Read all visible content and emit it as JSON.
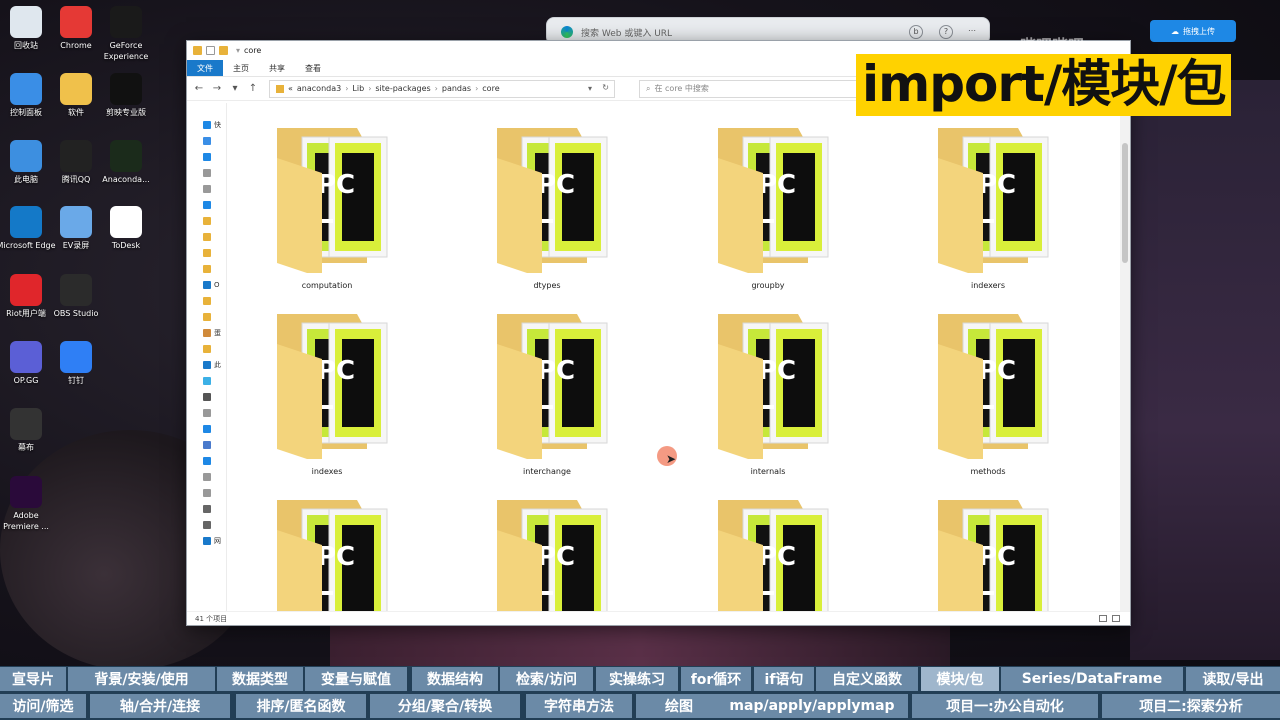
{
  "desktop": {
    "icons": [
      {
        "label": "回收站",
        "icon": "recycle-bin-icon",
        "color": "#dfe7ee"
      },
      {
        "label": "Chrome",
        "icon": "chrome-icon",
        "color": "#e53935"
      },
      {
        "label": "GeForce Experience",
        "icon": "geforce-icon",
        "color": "#1a1a1a"
      },
      {
        "label": "控制面板",
        "icon": "control-panel-icon",
        "color": "#3a8ee6"
      },
      {
        "label": "软件",
        "icon": "folder-icon",
        "color": "#f0c14b"
      },
      {
        "label": "剪映专业版",
        "icon": "capcut-icon",
        "color": "#111111"
      },
      {
        "label": "此电脑",
        "icon": "computer-icon",
        "color": "#3d8fe0"
      },
      {
        "label": "腾讯QQ",
        "icon": "qq-icon",
        "color": "#222222"
      },
      {
        "label": "Anaconda...",
        "icon": "anaconda-icon",
        "color": "#1b2b1b"
      },
      {
        "label": "Microsoft Edge",
        "icon": "edge-icon",
        "color": "#1479c8"
      },
      {
        "label": "EV录屏",
        "icon": "ev-recorder-icon",
        "color": "#6aa9e8"
      },
      {
        "label": "ToDesk",
        "icon": "todesk-icon",
        "color": "#ffffff"
      },
      {
        "label": "Riot用户端",
        "icon": "riot-icon",
        "color": "#e0262b"
      },
      {
        "label": "OBS Studio",
        "icon": "obs-icon",
        "color": "#2b2b2b"
      },
      {
        "label": "OP.GG",
        "icon": "opgg-icon",
        "color": "#5b5fd6"
      },
      {
        "label": "钉钉",
        "icon": "dingtalk-icon",
        "color": "#2f7ff5"
      },
      {
        "label": "幕布",
        "icon": "mubu-icon",
        "color": "#333333"
      },
      {
        "label": "Adobe Premiere ...",
        "icon": "premiere-icon",
        "color": "#2a0a3a"
      }
    ]
  },
  "browser": {
    "url_placeholder": "搜索 Web 或键入 URL",
    "login_label": "拖拽上传"
  },
  "explorer": {
    "title": "core",
    "ribbon_tabs": [
      "文件",
      "主页",
      "共享",
      "查看"
    ],
    "breadcrumb": [
      "«",
      "anaconda3",
      "Lib",
      "site-packages",
      "pandas",
      "core"
    ],
    "search_placeholder": "在 core 中搜索",
    "nav_items": [
      "快",
      "",
      "",
      "",
      "",
      "",
      "",
      "",
      "",
      "",
      "O",
      "",
      "",
      "蛋",
      "",
      "此",
      "",
      "",
      "",
      "",
      "",
      "",
      "",
      "",
      "",
      "",
      "网"
    ],
    "folders": [
      "computation",
      "dtypes",
      "groupby",
      "indexers",
      "indexes",
      "interchange",
      "internals",
      "methods",
      "",
      "",
      "",
      ""
    ],
    "status": "41 个项目"
  },
  "overlay": {
    "title": "import/模块/包",
    "watermark": "哔哩哔哩"
  },
  "chapters": {
    "row1": [
      "宣导片",
      "背景/安装/使用",
      "数据类型",
      "变量与赋值",
      "数据结构",
      "检索/访问",
      "实操练习",
      "for循环",
      "if语句",
      "自定义函数",
      "模块/包",
      "Series/DataFrame",
      "读取/导出"
    ],
    "row2": [
      "访问/筛选",
      "轴/合并/连接",
      "排序/匿名函数",
      "分组/聚合/转换",
      "字符串方法",
      "绘图",
      "map/apply/applymap",
      "项目一:办公自动化",
      "项目二:探索分析"
    ],
    "active": "模块/包"
  }
}
